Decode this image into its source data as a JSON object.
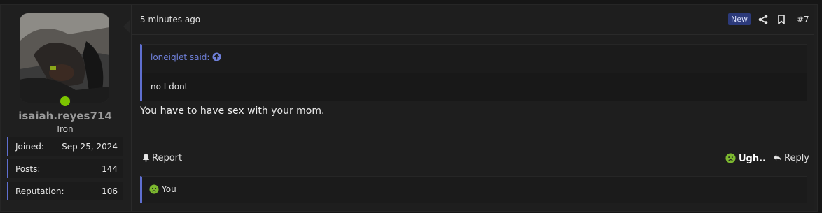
{
  "user": {
    "username": "isaiah.reyes714",
    "title": "Iron",
    "online": true,
    "stats": [
      {
        "label": "Joined:",
        "value": "Sep 25, 2024"
      },
      {
        "label": "Posts:",
        "value": "144"
      },
      {
        "label": "Reputation:",
        "value": "106"
      }
    ]
  },
  "post": {
    "time": "5 minutes ago",
    "new_badge": "New",
    "number": "#7",
    "quote": {
      "author_line": "loneiqlet said:",
      "text": "no I dont"
    },
    "message": "You have to have sex with your mom.",
    "actions": {
      "report": "Report",
      "reaction": "Ugh..",
      "reply": "Reply"
    },
    "reactions_summary": "You"
  },
  "colors": {
    "accent": "#5f6fd0",
    "online": "#7cc400",
    "reaction_face": "#7cb82f"
  },
  "icons": [
    "share-icon",
    "bookmark-icon",
    "arrow-up-circle-icon",
    "bell-icon",
    "ugh-emoji-icon",
    "reply-icon"
  ]
}
